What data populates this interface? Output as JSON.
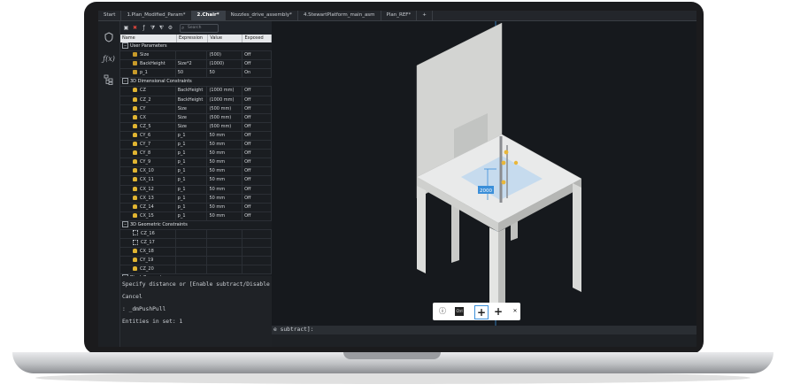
{
  "tabs": [
    {
      "label": "Start"
    },
    {
      "label": "1.Plan_Modified_Param*"
    },
    {
      "label": "2.Chair*"
    },
    {
      "label": "Nozzles_drive_assembly*"
    },
    {
      "label": "4.StewartPlatform_main_asm"
    },
    {
      "label": "Plan_REF*"
    },
    {
      "label": "+"
    }
  ],
  "toolbar": {
    "search_placeholder": "Search"
  },
  "table": {
    "headers": [
      "Name",
      "Expression",
      "Value",
      "Exposed"
    ],
    "rows": [
      {
        "kind": "group",
        "name": "User Parameters"
      },
      {
        "kind": "fx",
        "name": "Size",
        "expr": "",
        "value": "(500)",
        "exposed": "Off"
      },
      {
        "kind": "fx",
        "name": "BackHeight",
        "expr": "Size*2",
        "value": "(1000)",
        "exposed": "Off"
      },
      {
        "kind": "fx",
        "name": "p_1",
        "expr": "50",
        "value": "50",
        "exposed": "On"
      },
      {
        "kind": "group",
        "name": "3D Dimensional Constraints"
      },
      {
        "kind": "lock",
        "name": "CZ",
        "expr": "BackHeight",
        "value": "(1000 mm)",
        "exposed": "Off"
      },
      {
        "kind": "lock",
        "name": "CZ_2",
        "expr": "BackHeight",
        "value": "(1000 mm)",
        "exposed": "Off"
      },
      {
        "kind": "lock",
        "name": "CY",
        "expr": "Size",
        "value": "(500 mm)",
        "exposed": "Off"
      },
      {
        "kind": "lock",
        "name": "CX",
        "expr": "Size",
        "value": "(500 mm)",
        "exposed": "Off"
      },
      {
        "kind": "lock",
        "name": "CZ_5",
        "expr": "Size",
        "value": "(500 mm)",
        "exposed": "Off"
      },
      {
        "kind": "lock",
        "name": "CY_6",
        "expr": "p_1",
        "value": "50 mm",
        "exposed": "Off"
      },
      {
        "kind": "lock",
        "name": "CY_7",
        "expr": "p_1",
        "value": "50 mm",
        "exposed": "Off"
      },
      {
        "kind": "lock",
        "name": "CY_8",
        "expr": "p_1",
        "value": "50 mm",
        "exposed": "Off"
      },
      {
        "kind": "lock",
        "name": "CY_9",
        "expr": "p_1",
        "value": "50 mm",
        "exposed": "Off"
      },
      {
        "kind": "lock",
        "name": "CX_10",
        "expr": "p_1",
        "value": "50 mm",
        "exposed": "Off"
      },
      {
        "kind": "lock",
        "name": "CX_11",
        "expr": "p_1",
        "value": "50 mm",
        "exposed": "Off"
      },
      {
        "kind": "lock",
        "name": "CX_12",
        "expr": "p_1",
        "value": "50 mm",
        "exposed": "Off"
      },
      {
        "kind": "lock",
        "name": "CX_13",
        "expr": "p_1",
        "value": "50 mm",
        "exposed": "Off"
      },
      {
        "kind": "lock",
        "name": "CZ_14",
        "expr": "p_1",
        "value": "50 mm",
        "exposed": "Off"
      },
      {
        "kind": "lock",
        "name": "CX_15",
        "expr": "p_1",
        "value": "50 mm",
        "exposed": "Off"
      },
      {
        "kind": "group",
        "name": "3D Geometric Constraints"
      },
      {
        "kind": "geo",
        "name": "CZ_16",
        "expr": "",
        "value": "",
        "exposed": ""
      },
      {
        "kind": "geo",
        "name": "CZ_17",
        "expr": "",
        "value": "",
        "exposed": ""
      },
      {
        "kind": "lock",
        "name": "CX_18",
        "expr": "",
        "value": "",
        "exposed": ""
      },
      {
        "kind": "lock",
        "name": "CY_19",
        "expr": "",
        "value": "",
        "exposed": ""
      },
      {
        "kind": "lock",
        "name": "CZ_20",
        "expr": "",
        "value": "",
        "exposed": ""
      },
      {
        "kind": "group",
        "name": "Block Parameters"
      },
      {
        "kind": "group",
        "name": "Array Parameters"
      }
    ]
  },
  "command": {
    "lines": [
      "Specify distance or [Enable subtract/Disable subtract]:",
      "Cancel",
      ": _dmPushPull",
      "Entities in set: 1"
    ],
    "prompt": "e subtract]:"
  },
  "viewport": {
    "dimension_label": "2000"
  },
  "widget": {
    "ctrl_label": "Ctrl"
  },
  "colors": {
    "accent": "#3b8fd9",
    "dark_bg": "#16191d",
    "lock": "#e0b431"
  }
}
